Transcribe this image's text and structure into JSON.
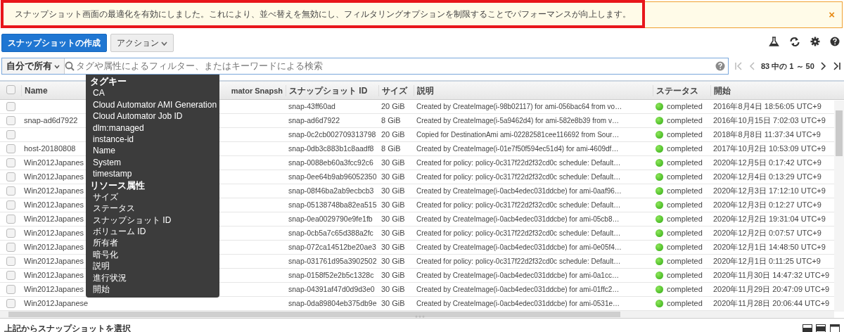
{
  "alert": {
    "message": "スナップショット画面の最適化を有効にしました。これにより、並べ替えを無効にし、フィルタリングオプションを制限することでパフォーマンスが向上します。",
    "highlighted": true,
    "close": "×"
  },
  "toolbar": {
    "create_button": "スナップショットの作成",
    "actions_button": "アクション"
  },
  "filter": {
    "scope": "自分で所有",
    "placeholder": "タグや属性によるフィルター、またはキーワードによる検索"
  },
  "pagination": {
    "summary": "83 中の 1 ～ 50"
  },
  "filter_menu": [
    {
      "kind": "header",
      "label": "タグキー"
    },
    {
      "kind": "option",
      "label": "CA"
    },
    {
      "kind": "option",
      "label": "Cloud Automator AMI Generation"
    },
    {
      "kind": "option",
      "label": "Cloud Automator Job ID"
    },
    {
      "kind": "option",
      "label": "dlm:managed"
    },
    {
      "kind": "option",
      "label": "instance-id"
    },
    {
      "kind": "option",
      "label": "Name"
    },
    {
      "kind": "option",
      "label": "System"
    },
    {
      "kind": "option",
      "label": "timestamp"
    },
    {
      "kind": "header",
      "label": "リソース属性"
    },
    {
      "kind": "option",
      "label": "サイズ"
    },
    {
      "kind": "option",
      "label": "ステータス"
    },
    {
      "kind": "option",
      "label": "スナップショット ID"
    },
    {
      "kind": "option",
      "label": "ボリューム ID"
    },
    {
      "kind": "option",
      "label": "所有者"
    },
    {
      "kind": "option",
      "label": "暗号化"
    },
    {
      "kind": "option",
      "label": "説明"
    },
    {
      "kind": "option",
      "label": "進行状況"
    },
    {
      "kind": "option",
      "label": "開始"
    }
  ],
  "table": {
    "select_all_checked": false,
    "columns": [
      "Name",
      "mator Snapsh",
      "スナップショット ID",
      "サイズ",
      "説明",
      "ステータス",
      "開始"
    ],
    "rows": [
      {
        "checked": false,
        "name": "",
        "snapshot_id": "snap-43ff60ad",
        "size": "20 GiB",
        "description": "Created by CreateImage(i-98b02117) for ami-056bac64 from vo…",
        "status": "completed",
        "started": "2016年8月4日 18:56:05 UTC+9"
      },
      {
        "checked": false,
        "name": "snap-ad6d7922",
        "snapshot_id": "snap-ad6d7922",
        "size": "8 GiB",
        "description": "Created by CreateImage(i-5a9462d4) for ami-582e8b39 from v…",
        "status": "completed",
        "started": "2016年10月15日 7:02:03 UTC+9"
      },
      {
        "checked": false,
        "name": "",
        "snapshot_id": "snap-0c2cb002709313798",
        "size": "20 GiB",
        "description": "Copied for DestinationAmi ami-02282581cee116692 from Sour…",
        "status": "completed",
        "started": "2018年8月8日 11:37:34 UTC+9"
      },
      {
        "checked": false,
        "name": "host-20180808",
        "snapshot_id": "snap-0db3c883b1c8aadf8",
        "size": "8 GiB",
        "description": "Created by CreateImage(i-01e7f50f594ec51d4) for ami-4609df…",
        "status": "completed",
        "started": "2017年10月2日 10:53:09 UTC+9"
      },
      {
        "checked": false,
        "name": "Win2012Japanes",
        "snapshot_id": "snap-0088eb60a3fcc92c6",
        "size": "30 GiB",
        "description": "Created for policy: policy-0c317f22d2f32cd0c schedule: Default…",
        "status": "completed",
        "started": "2020年12月5日 0:17:42 UTC+9"
      },
      {
        "checked": false,
        "name": "Win2012Japanes",
        "snapshot_id": "snap-0ee64b9ab96052350",
        "size": "30 GiB",
        "description": "Created for policy: policy-0c317f22d2f32cd0c schedule: Default…",
        "status": "completed",
        "started": "2020年12月4日 0:13:29 UTC+9"
      },
      {
        "checked": false,
        "name": "Win2012Japanes",
        "snapshot_id": "snap-08f46ba2ab9ecbcb3",
        "size": "30 GiB",
        "description": "Created by CreateImage(i-0acb4edec031ddcbe) for ami-0aaf96…",
        "status": "completed",
        "started": "2020年12月3日 17:12:10 UTC+9"
      },
      {
        "checked": false,
        "name": "Win2012Japanes",
        "snapshot_id": "snap-05138748ba82ea515",
        "size": "30 GiB",
        "description": "Created for policy: policy-0c317f22d2f32cd0c schedule: Default…",
        "status": "completed",
        "started": "2020年12月3日 0:12:27 UTC+9"
      },
      {
        "checked": false,
        "name": "Win2012Japanes",
        "snapshot_id": "snap-0ea0029790e9fe1fb",
        "size": "30 GiB",
        "description": "Created by CreateImage(i-0acb4edec031ddcbe) for ami-05cb8…",
        "status": "completed",
        "started": "2020年12月2日 19:31:04 UTC+9"
      },
      {
        "checked": false,
        "name": "Win2012Japanes",
        "snapshot_id": "snap-0cb5a7c65d388a2fc",
        "size": "30 GiB",
        "description": "Created for policy: policy-0c317f22d2f32cd0c schedule: Default…",
        "status": "completed",
        "started": "2020年12月2日 0:07:57 UTC+9"
      },
      {
        "checked": false,
        "name": "Win2012Japanes",
        "snapshot_id": "snap-072ca14512be20ae3",
        "size": "30 GiB",
        "description": "Created by CreateImage(i-0acb4edec031ddcbe) for ami-0e05f4…",
        "status": "completed",
        "started": "2020年12月1日 14:48:50 UTC+9"
      },
      {
        "checked": false,
        "name": "Win2012Japanes",
        "snapshot_id": "snap-031761d95a3902502",
        "size": "30 GiB",
        "description": "Created for policy: policy-0c317f22d2f32cd0c schedule: Default…",
        "status": "completed",
        "started": "2020年12月1日 0:11:25 UTC+9"
      },
      {
        "checked": false,
        "name": "Win2012Japanes",
        "snapshot_id": "snap-0158f52e2b5c1328c",
        "size": "30 GiB",
        "description": "Created by CreateImage(i-0acb4edec031ddcbe) for ami-0a1cc…",
        "status": "completed",
        "started": "2020年11月30日 14:47:32 UTC+9"
      },
      {
        "checked": false,
        "name": "Win2012Japanes",
        "snapshot_id": "snap-04391af47d0d9d3e0",
        "size": "30 GiB",
        "description": "Created by CreateImage(i-0acb4edec031ddcbe) for ami-01ffc2…",
        "status": "completed",
        "started": "2020年11月29日 20:47:09 UTC+9"
      },
      {
        "checked": false,
        "name": "Win2012Japanese",
        "snapshot_id": "snap-0da89804eb375db9e",
        "size": "30 GiB",
        "description": "Created by CreateImage(i-0acb4edec031ddcbe) for ami-0531e…",
        "status": "completed",
        "started": "2020年11月28日 20:06:44 UTC+9"
      }
    ]
  },
  "footer": {
    "detail_prompt": "上記からスナップショットを選択"
  }
}
